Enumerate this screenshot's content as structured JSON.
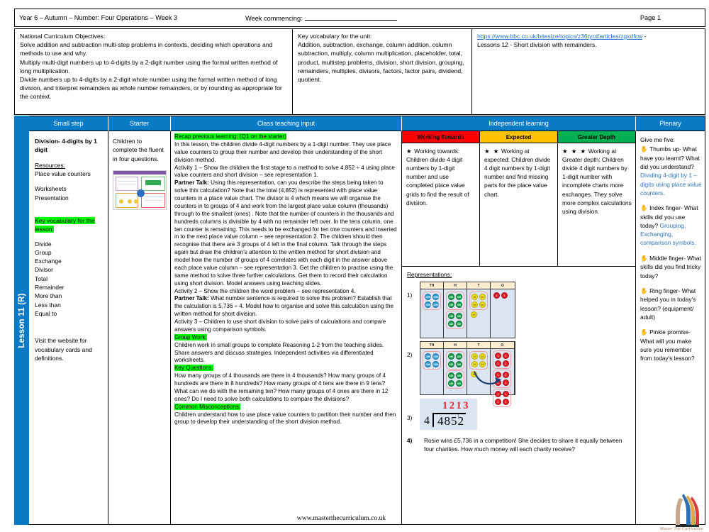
{
  "header": {
    "unit_title": "Year 6 – Autumn – Number: Four Operations – Week 3",
    "week_commencing_label": "Week commencing:",
    "page_label": "Page 1"
  },
  "info": {
    "nc_heading": "National Curriculum Objectives:",
    "nc_text": "Solve addition and subtraction multi-step problems in contexts, deciding which operations and methods to use and why.\nMultiply multi-digit numbers up to 4-digits by a 2-digit number using the formal written method of long multiplication.\nDivide numbers up to 4-digits by a 2-digit whole number using the formal written method of long division, and interpret remainders as whole number remainders, or by rounding as appropriate for the context.",
    "vocab_heading": "Key vocabulary for the unit:",
    "vocab_text": "Addition, subtraction, exchange, column addition, column subtraction, multiply, column multiplication, placeholder, total,  product, multistep problems, division, short division, grouping, remainders, multiples, divisors, factors, factor pairs, dividend, quotient.",
    "link_url": "https://www.bbc.co.uk/bitesize/topics/z36tyrd/articles/zgxdfcw",
    "link_tail": " -",
    "link_note": "Lessons 12 - Short division with remainders."
  },
  "lesson_tab": {
    "label": "Lesson 11 (R)"
  },
  "columns": {
    "small_step": "Small step",
    "starter": "Starter",
    "class_input": "Class teaching input",
    "independent": "Independent learning",
    "plenary": "Plenary"
  },
  "small_step": {
    "title": "Division- 4-digits by 1 digit",
    "resources_heading": "Resources:",
    "resources_line1": "Place value counters",
    "resources_line2": "Worksheets",
    "resources_line3": "Presentation",
    "vocab_heading": "Key vocabulary for the lesson:",
    "vocab_words": [
      "Divide",
      "Group",
      "Exchange",
      "Divisor",
      "Total",
      "Remainder",
      "More than",
      "Less than",
      "Equal to"
    ],
    "footer_note": "Visit the website for vocabulary cards and definitions."
  },
  "starter": {
    "text": "Children to complete the fluent in four questions.",
    "image_alt": "fluent-in-four-slide-thumbnail"
  },
  "class_input": {
    "recap_heading": "Recap previous learning: (Q1 on the starter)",
    "intro": "In this lesson, the children divide 4-digit numbers by a 1-digit number. They use place value counters to group their number and develop their understanding of the short division method.",
    "activity1": "Activity 1 – Show the children the first stage to a method to solve 4,852 ÷ 4 using place value counters and short division – see representation 1.",
    "partner_talk1_label": "Partner Talk:",
    "partner_talk1": " Using this representation, can you describe the steps being taken to solve this calculation? Note that the total (4,852) is  represented with place value counters in a place value chart. The divisor is 4 which means we will organise the counters in to groups of 4 and work from the largest place value column (thousands) through to the smallest (ones) . Note that the number of  counters in the thousands and hundreds columns is divisible by 4 with no remainder left over. In the tens column, one ten counter is remaining. This needs to be exchanged for ten one counters and inserted in to the next place value column – see representation 2. The children should then recognise that there are 3 groups of 4 left in the final column. Talk through the steps again but draw the children's attention to the written method for short division and model how the number of groups of 4 correlates with each digit in the answer above each place value column – see representation 3. Get the children to practise using the same method to solve three further calculations. Get them to record their calculation using short division. Model answers using teaching slides.",
    "activity2": "Activity 2 – Show the children the word problem – see representation 4.",
    "partner_talk2_label": "Partner Talk:",
    "partner_talk2": " What number sentence is required to solve this problem? Establish that the calculation is 5,736 ÷ 4. Model how to organise and solve this calculation using the written method for short division.",
    "activity3": "Activity 3 – Children to use short division to solve pairs of calculations and compare answers using comparison symbols.",
    "group_work_heading": "Group Work:",
    "group_work": "Children work in small groups to complete Reasoning 1-2 from the teaching slides. Share answers and discuss strategies. Independent activities via differentiated worksheets.",
    "key_questions_heading": "Key Questions:",
    "key_questions": "How many groups of 4 thousands are there in 4 thousands? How many groups of 4 hundreds are there in 8 hundreds? How many groups of 4 tens are there in 9 tens? What can we do with the remaining ten? How many groups of 4 ones are there in 12 ones? Do I need to solve both calculations to compare the divisions?",
    "misconceptions_heading": "Common Misconceptions:",
    "misconceptions": "Children understand how to use place value counters to partition their number and then group to develop their understanding of the short division method.",
    "website_footer": "www.masterthecurriculum.co.uk"
  },
  "independent": {
    "bands": [
      {
        "label": "Working Towards",
        "color": "#ff0000",
        "stars": "★",
        "lead": "Working towards:",
        "text": "Children divide 4 digit numbers by 1-digit number and use completed place value grids to find the result of division."
      },
      {
        "label": "Expected",
        "color": "#ffc000",
        "stars": "★ ★",
        "lead": "Working at expected:",
        "text": "Children divide 4 digit numbers by 1-digit number and find missing parts for the place value chart."
      },
      {
        "label": "Greater Depth",
        "color": "#00b050",
        "stars": "★ ★ ★",
        "lead": "Working at Greater depth:",
        "text": "Children divide 4 digit numbers by 1-digit number with incomplete charts more exchanges. They solve more complex calculations using division."
      }
    ],
    "representations_heading": "Representations:",
    "rep1_number": "1)",
    "rep2_number": "2)",
    "rep3_number": "3)",
    "rep4_number": "4)",
    "pv_headers": [
      "TH",
      "H",
      "T",
      "O"
    ],
    "short_division": {
      "answer": "1213",
      "divisor": "4",
      "dividend": "4852",
      "carry": "1"
    },
    "word_problem": "Rosie wins £5,736 in a competition! She decides to share it equally between four charities. How much money will each charity receive?"
  },
  "plenary": {
    "heading": "Give me five:",
    "items": [
      {
        "icon": "hand-icon",
        "prompt": "Thumbs up- What have you learnt? What did you understand?",
        "answer": "Dividing 4-digit by 1 –digits using place value counters."
      },
      {
        "icon": "hand-icon",
        "prompt": "Index finger- What skills did you use today?",
        "answer": "Grouping, Exchanging, comparison symbols."
      },
      {
        "icon": "hand-icon",
        "prompt": "Middle finger- What skills did you find tricky today?",
        "answer": ""
      },
      {
        "icon": "hand-icon",
        "prompt": "Ring finger- What helped you in today's lesson? (equipment/ adult)",
        "answer": ""
      },
      {
        "icon": "hand-icon",
        "prompt": "Pinkie promise- What will you make sure you remember from today's lesson?",
        "answer": ""
      }
    ]
  },
  "footer": {
    "logo_caption": "Master The Curriculum"
  }
}
